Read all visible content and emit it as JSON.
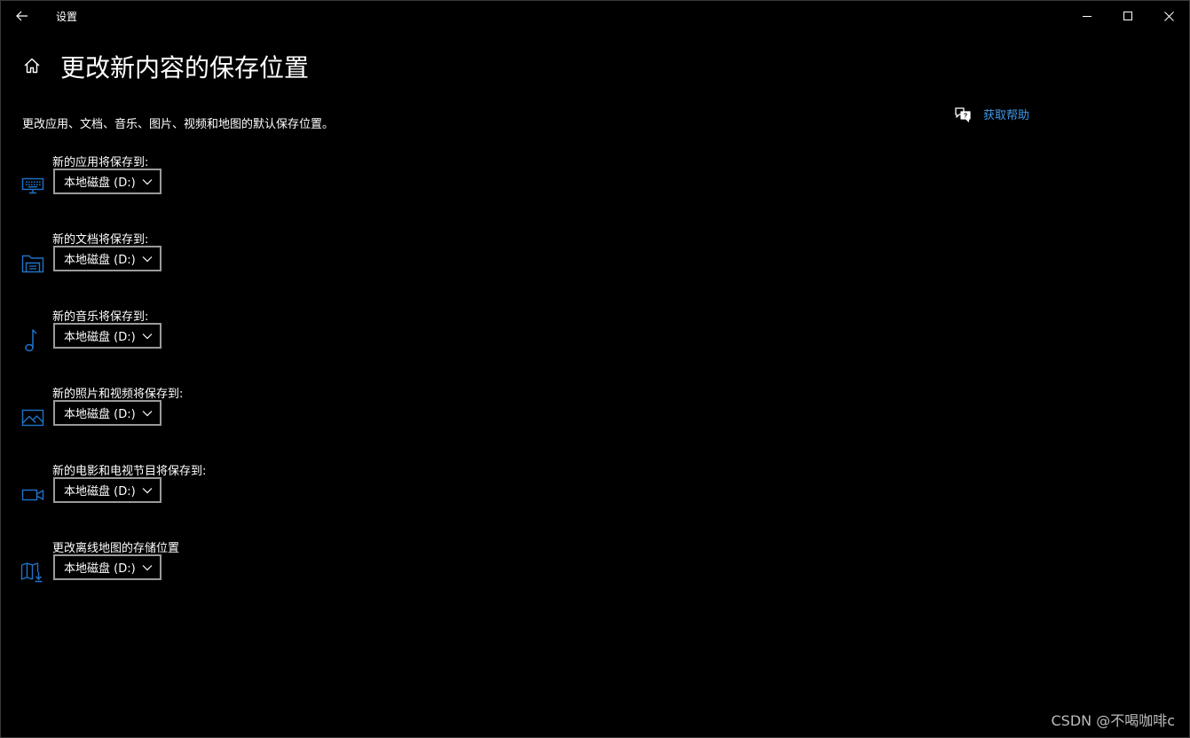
{
  "window": {
    "title": "设置"
  },
  "header": {
    "title": "更改新内容的保存位置",
    "description": "更改应用、文档、音乐、图片、视频和地图的默认保存位置。"
  },
  "help": {
    "label": "获取帮助"
  },
  "settings": [
    {
      "label": "新的应用将保存到:",
      "value": "本地磁盘 (D:)",
      "icon": "monitor-icon"
    },
    {
      "label": "新的文档将保存到:",
      "value": "本地磁盘 (D:)",
      "icon": "folder-icon"
    },
    {
      "label": "新的音乐将保存到:",
      "value": "本地磁盘 (D:)",
      "icon": "music-note-icon"
    },
    {
      "label": "新的照片和视频将保存到:",
      "value": "本地磁盘 (D:)",
      "icon": "picture-icon"
    },
    {
      "label": "新的电影和电视节目将保存到:",
      "value": "本地磁盘 (D:)",
      "icon": "video-camera-icon"
    },
    {
      "label": "更改离线地图的存储位置",
      "value": "本地磁盘 (D:)",
      "icon": "map-download-icon"
    }
  ],
  "watermark": "CSDN @不喝咖啡c",
  "colors": {
    "background": "#000000",
    "accent": "#3e9ae8",
    "icon_blue": "#1e73c8",
    "text": "#ffffff",
    "border": "#9a9a9a"
  }
}
